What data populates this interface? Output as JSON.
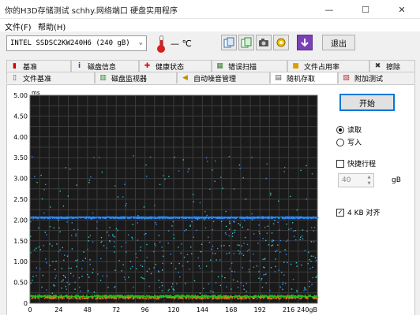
{
  "window": {
    "title": "你的H3D存储测试 schhy.网络端口 硬盘实用程序",
    "controls": {
      "minimize": "—",
      "maximize": "☐",
      "close": "✕"
    }
  },
  "menu": [
    "文件(F)",
    "帮助(H)"
  ],
  "toolbar": {
    "drive": "INTEL SSDSC2KW240H6 (240 gB)",
    "temperature": "— ℃",
    "icons": [
      "copy-icon",
      "copy-all-icon",
      "camera-icon",
      "options-icon",
      "download-icon"
    ],
    "exit": "退出"
  },
  "tabs_row1": [
    {
      "label": "基准",
      "icon": "benchmark-icon"
    },
    {
      "label": "磁盘信息",
      "icon": "info-icon"
    },
    {
      "label": "健康状态",
      "icon": "health-icon"
    },
    {
      "label": "错误扫描",
      "icon": "error-scan-icon"
    },
    {
      "label": "文件占用率",
      "icon": "folder-icon"
    },
    {
      "label": "擦除",
      "icon": "erase-icon"
    }
  ],
  "tabs_row2": [
    {
      "label": "文件基准",
      "icon": "file-benchmark-icon"
    },
    {
      "label": "磁盘监视器",
      "icon": "monitor-icon"
    },
    {
      "label": "自动噪音管理",
      "icon": "speaker-icon"
    },
    {
      "label": "随机存取",
      "icon": "random-access-icon",
      "active": true
    },
    {
      "label": "附加测试",
      "icon": "extra-test-icon"
    }
  ],
  "side": {
    "start": "开始",
    "read": "读取",
    "write": "写入",
    "mode_selected": "read",
    "fast_stroke": "快捷行程",
    "fast_stroke_checked": false,
    "stroke_value": "40",
    "stroke_unit": "gB",
    "align_4kb": "4 KB 对齐",
    "align_checked": true
  },
  "chart_data": {
    "type": "scatter",
    "ylabel": "ms",
    "ylim": [
      0,
      5.0
    ],
    "y_ticks": [
      "5.00",
      "4.50",
      "4.00",
      "3.50",
      "3.00",
      "2.50",
      "2.00",
      "1.50",
      "1.00",
      "0.50",
      "0"
    ],
    "x_ticks": [
      "0",
      "24",
      "48",
      "72",
      "96",
      "120",
      "144",
      "168",
      "192",
      "216",
      "240gB"
    ],
    "xlim": [
      0,
      240
    ],
    "grid": true,
    "series": [
      {
        "color": "#2a8cff",
        "band_y": 2.07,
        "avg": 2.07
      },
      {
        "color": "#19c21f",
        "band_y": 0.18,
        "avg": 0.16
      },
      {
        "color": "#e07b1a",
        "band_y": 0.14
      }
    ],
    "colors": {
      "background": "#1a1a1a",
      "grid": "#3c3c3c",
      "scatter_blue": "#3a8fff",
      "scatter_teal": "#2fd1c0",
      "scatter_green": "#28c828"
    }
  }
}
